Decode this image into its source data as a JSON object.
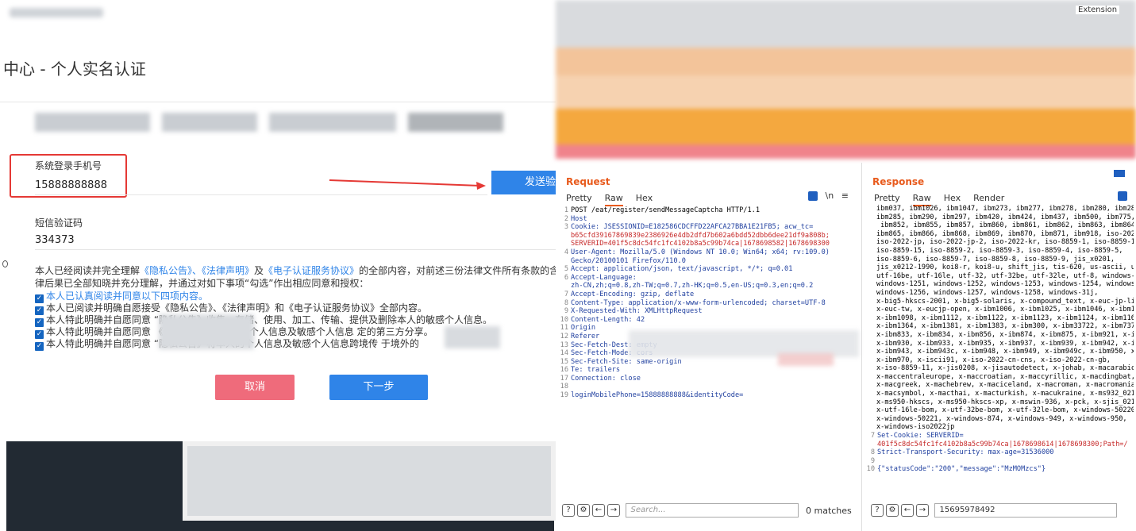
{
  "web": {
    "title": "中心 - 个人实名认证",
    "phone_label": "系统登录手机号",
    "phone_value": "15888888888",
    "send_button": "发送验证码",
    "sms_label": "短信验证码",
    "sms_value": "334373",
    "agreement_intro_1": "本人已经阅读并完全理解",
    "agreement_link_1": "《隐私公告》、《法律声明》",
    "agreement_and": "及",
    "agreement_link_2": "《电子认证服务协议》",
    "agreement_intro_2": "的全部内容，对前述三份法律文件所有条款的含义",
    "agreement_line2": "律后果已全部知晓并充分理解，并通过对如下事项“勾选”作出相应同意和授权：",
    "check_items": [
      "本人已认真阅读并同意以下四项内容。",
      "本人已阅读并明确自愿接受《隐私公告》、《法律声明》和《电子认证服务协议》全部内容。",
      "本人特此明确并自愿同意              “隐私公告》收集、存储、使用、加工、传输、提供及删除本人的敏感个人信息。",
      "本人特此明确并自愿同意              《隐私公告》将本人的个人信息及敏感个人信息                定的第三方分享。",
      "本人特此明确并自愿同意              “隐私公告》将本人的个人信息及敏感个人信息跨境传                于境外的"
    ],
    "cancel_button": "取消",
    "next_button": "下一步"
  },
  "burp": {
    "extension_label": "Extension",
    "request_title": "Request",
    "response_title": "Response",
    "request_tabs": [
      "Pretty",
      "Raw",
      "Hex"
    ],
    "response_tabs": [
      "Pretty",
      "Raw",
      "Hex",
      "Render"
    ],
    "request_lines": [
      {
        "n": "1",
        "t": "POST /eat/register/sendMessageCaptcha HTTP/1.1"
      },
      {
        "n": "2",
        "t": "Host"
      },
      {
        "n": "3",
        "t": "Cookie: JSESSIONID=E182586CDCFFD22AFCA27BBA1E21FB5; acw_tc="
      },
      {
        "n": "",
        "t": "b65cfd39167869839e2386926e4db2dfd7b602a6bdd52dbb6dee21df9a808b;"
      },
      {
        "n": "",
        "t": "SERVERID=401f5c8dc54fc1fc4102b8a5c99b74ca|1678698582|1678698300"
      },
      {
        "n": "4",
        "t": "User-Agent: Mozilla/5.0 (Windows NT 10.0; Win64; x64; rv:109.0)"
      },
      {
        "n": "",
        "t": "Gecko/20100101 Firefox/110.0"
      },
      {
        "n": "5",
        "t": "Accept: application/json, text/javascript, */*; q=0.01"
      },
      {
        "n": "6",
        "t": "Accept-Language:"
      },
      {
        "n": "",
        "t": "zh-CN,zh;q=0.8,zh-TW;q=0.7,zh-HK;q=0.5,en-US;q=0.3,en;q=0.2"
      },
      {
        "n": "7",
        "t": "Accept-Encoding: gzip, deflate"
      },
      {
        "n": "8",
        "t": "Content-Type: application/x-www-form-urlencoded; charset=UTF-8"
      },
      {
        "n": "9",
        "t": "X-Requested-With: XMLHttpRequest"
      },
      {
        "n": "10",
        "t": "Content-Length: 42"
      },
      {
        "n": "11",
        "t": "Origin"
      },
      {
        "n": "12",
        "t": "Referer"
      },
      {
        "n": "13",
        "t": "Sec-Fetch-Dest: empty"
      },
      {
        "n": "14",
        "t": "Sec-Fetch-Mode: cors"
      },
      {
        "n": "15",
        "t": "Sec-Fetch-Site: same-origin"
      },
      {
        "n": "16",
        "t": "Te: trailers"
      },
      {
        "n": "17",
        "t": "Connection: close"
      },
      {
        "n": "18",
        "t": ""
      },
      {
        "n": "19",
        "t": "loginMobilePhone=15888888888&identityCode="
      }
    ],
    "response_lines": [
      "ibm037, ibm1026, ibm1047, ibm273, ibm277, ibm278, ibm280, ibm28",
      "ibm285, ibm290, ibm297, ibm420, ibm424, ibm437, ibm500, ibm775,",
      " ibm852, ibm855, ibm857, ibm860, ibm861, ibm862, ibm863, ibm864",
      "ibm865, ibm866, ibm868, ibm869, ibm870, ibm871, ibm918, iso-202",
      "iso-2022-jp, iso-2022-jp-2, iso-2022-kr, iso-8859-1, iso-8859-1",
      "iso-8859-15, iso-8859-2, iso-8859-3, iso-8859-4, iso-8859-5,",
      "iso-8859-6, iso-8859-7, iso-8859-8, iso-8859-9, jis_x0201,",
      "jis_x0212-1990, koi8-r, koi8-u, shift_jis, tis-620, us-ascii, u",
      "utf-16be, utf-16le, utf-32, utf-32be, utf-32le, utf-8, windows-",
      "windows-1251, windows-1252, windows-1253, windows-1254, windows",
      "windows-1256, windows-1257, windows-1258, windows-31j,",
      "x-big5-hkscs-2001, x-big5-solaris, x-compound_text, x-euc-jp-li",
      "x-euc-tw, x-eucjp-open, x-ibm1006, x-ibm1025, x-ibm1046, x-ibm1",
      "x-ibm1098, x-ibm1112, x-ibm1122, x-ibm1123, x-ibm1124, x-ibm116",
      "x-ibm1364, x-ibm1381, x-ibm1383, x-ibm300, x-ibm33722, x-ibm737",
      "x-ibm833, x-ibm834, x-ibm856, x-ibm874, x-ibm875, x-ibm921, x-i",
      "x-ibm930, x-ibm933, x-ibm935, x-ibm937, x-ibm939, x-ibm942, x-i",
      "x-ibm943, x-ibm943c, x-ibm948, x-ibm949, x-ibm949c, x-ibm950, x",
      "x-ibm970, x-iscii91, x-iso-2022-cn-cns, x-iso-2022-cn-gb,",
      "x-iso-8859-11, x-jis0208, x-jisautodetect, x-johab, x-macarabic",
      "x-maccentraleurope, x-maccroatian, x-maccyrillic, x-macdingbat,",
      "x-macgreek, x-machebrew, x-maciceland, x-macroman, x-macromania",
      "x-macsymbol, x-macthai, x-macturkish, x-macukraine, x-ms932_021",
      "x-ms950-hkscs, x-ms950-hkscs-xp, x-mswin-936, x-pck, x-sjis_021",
      "x-utf-16le-bom, x-utf-32be-bom, x-utf-32le-bom, x-windows-50220",
      "x-windows-50221, x-windows-874, x-windows-949, x-windows-950,",
      "x-windows-iso2022jp"
    ],
    "response_tail": [
      {
        "n": "7",
        "t": "Set-Cookie: SERVERID="
      },
      {
        "n": "",
        "t": "401f5c8dc54fc1fc4102b8a5c99b74ca|1678698614|1678698300;Path=/"
      },
      {
        "n": "8",
        "t": "Strict-Transport-Security: max-age=31536000"
      },
      {
        "n": "9",
        "t": ""
      },
      {
        "n": "10",
        "t": "{\"statusCode\":\"200\",\"message\":\"MzMOMzcs\"}"
      }
    ],
    "req_search_placeholder": "Search...",
    "req_matches": "0 matches",
    "resp_search_value": "15695978492"
  },
  "colors": {
    "accent_blue": "#2f84e8",
    "burp_orange": "#e85a1c",
    "annotation_red": "#e53935"
  }
}
